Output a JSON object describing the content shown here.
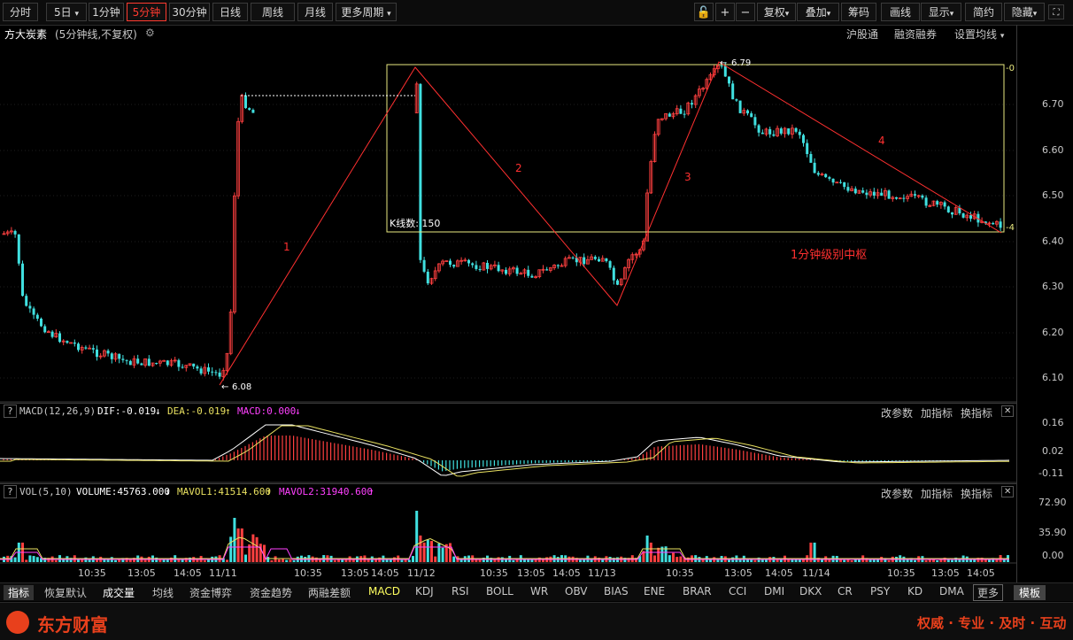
{
  "toolbar": {
    "tabs": [
      "分时",
      "5日",
      "1分钟",
      "5分钟",
      "30分钟",
      "日线",
      "周线",
      "月线",
      "更多周期"
    ],
    "active_tab": "5分钟",
    "right_buttons": [
      "复权",
      "叠加",
      "筹码",
      "画线",
      "显示",
      "简约",
      "隐藏"
    ]
  },
  "stock": {
    "name": "方大炭素",
    "sub": "(5分钟线,不复权)",
    "links": [
      "沪股通",
      "融资融券",
      "设置均线"
    ]
  },
  "price_axis": [
    "6.70",
    "6.60",
    "6.50",
    "6.40",
    "6.30",
    "6.20",
    "6.10"
  ],
  "annotations": {
    "low_label": "6.08",
    "high_label": "6.79",
    "kcount_label": "K线数: 150",
    "center_label": "1分钟级别中枢",
    "seg_labels": [
      "1",
      "2",
      "3",
      "4"
    ],
    "box_top_mark": "0",
    "box_bottom_mark": "4"
  },
  "time_axis": [
    "10:35",
    "13:05",
    "14:05",
    "11/11",
    "10:35",
    "13:05",
    "14:05",
    "11/12",
    "10:35",
    "13:05",
    "14:05",
    "11/13",
    "10:35",
    "13:05",
    "14:05",
    "11/14",
    "10:35",
    "13:05",
    "14:05"
  ],
  "macd": {
    "name": "MACD(12,26,9)",
    "dif": "DIF:-0.019",
    "dea": "DEA:-0.019",
    "macd": "MACD:0.000",
    "axis": [
      "0.16",
      "0.02",
      "-0.11"
    ]
  },
  "vol": {
    "name": "VOL(5,10)",
    "volume": "VOLUME:45763.000",
    "mavol1": "MAVOL1:41514.600",
    "mavol2": "MAVOL2:31940.600",
    "axis": [
      "72.90",
      "35.90",
      "0.00"
    ]
  },
  "panel_buttons": [
    "改参数",
    "加指标",
    "换指标"
  ],
  "indicator_tabs": [
    "指标",
    "恢复默认",
    "成交量",
    "均线",
    "资金博弈",
    "资金趋势",
    "两融差额",
    "MACD",
    "KDJ",
    "RSI",
    "BOLL",
    "WR",
    "OBV",
    "BIAS",
    "ENE",
    "BRAR",
    "CCI",
    "DMI",
    "DKX",
    "CR",
    "PSY",
    "KD",
    "DMA",
    "更多",
    "模板"
  ],
  "footer": {
    "brand": "东方财富",
    "slogan": "权威 · 专业 · 及时 · 互动"
  },
  "colors": {
    "up": "#ff4040",
    "down": "#40e0e0",
    "annotation": "#ff3030",
    "box": "#e8e880",
    "dea": "#e8e060"
  }
}
